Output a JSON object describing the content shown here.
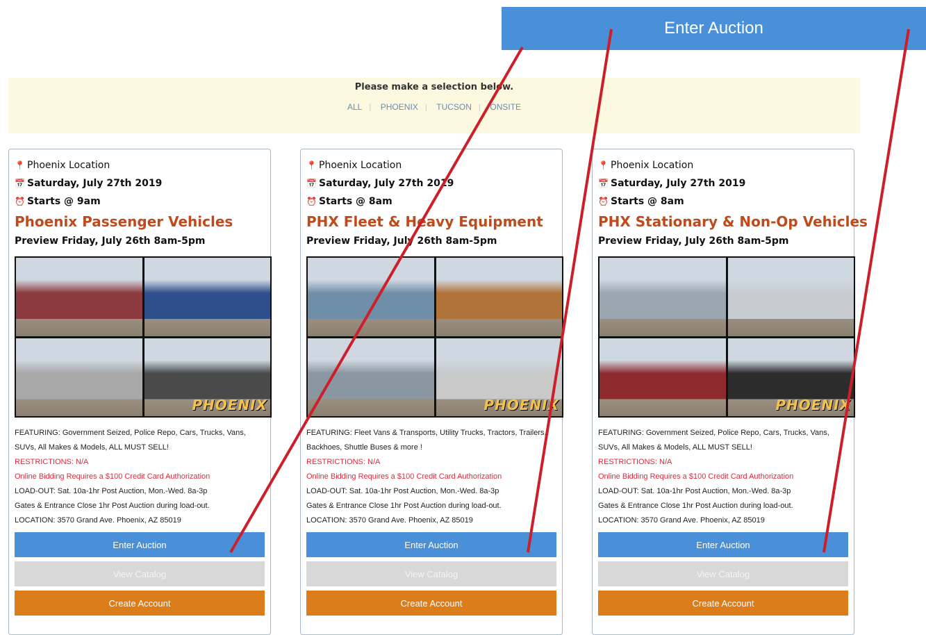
{
  "callout": {
    "label": "Enter Auction"
  },
  "filter": {
    "prompt": "Please make a selection below.",
    "options": [
      "ALL",
      "PHOENIX",
      "TUCSON",
      "ONSITE"
    ]
  },
  "cards": [
    {
      "location": "Phoenix Location",
      "date": "Saturday, July 27th 2019",
      "starts": "Starts @ 9am",
      "title": "Phoenix Passenger Vehicles",
      "preview": "Preview Friday, July 26th 8am-5pm",
      "watermark": "PHOENIX",
      "featuring": "FEATURING: Government Seized, Police Repo, Cars, Trucks, Vans, SUVs, All Makes & Models, ALL MUST SELL!",
      "restrictions": "RESTRICTIONS: N/A",
      "online": "Online Bidding Requires a $100 Credit Card Authorization",
      "loadout": "LOAD-OUT: Sat. 10a-1hr Post Auction, Mon.-Wed. 8a-3p",
      "gates": "Gates & Entrance Close 1hr Post Auction during load-out.",
      "address": "LOCATION: 3570 Grand Ave. Phoenix, AZ 85019",
      "enter": "Enter Auction",
      "catalog": "View Catalog",
      "account": "Create Account",
      "photo_colors": [
        "#8c3a3e",
        "#2e4f8c",
        "#a8a8a8",
        "#4a4a4a"
      ]
    },
    {
      "location": "Phoenix Location",
      "date": "Saturday, July 27th 2019",
      "starts": "Starts @ 8am",
      "title": "PHX Fleet & Heavy Equipment",
      "preview": "Preview Friday, July 26th 8am-5pm",
      "watermark": "PHOENIX",
      "featuring": "FEATURING: Fleet Vans & Transports, Utility Trucks, Tractors, Trailers, Backhoes, Shuttle Buses & more !",
      "restrictions": "RESTRICTIONS: N/A",
      "online": "Online Bidding Requires a $100 Credit Card Authorization",
      "loadout": "LOAD-OUT: Sat. 10a-1hr Post Auction, Mon.-Wed. 8a-3p",
      "gates": "Gates & Entrance Close 1hr Post Auction during load-out.",
      "address": "LOCATION: 3570 Grand Ave. Phoenix, AZ 85019",
      "enter": "Enter Auction",
      "catalog": "View Catalog",
      "account": "Create Account",
      "photo_colors": [
        "#6f8ea8",
        "#b0733a",
        "#8a96a0",
        "#c9c9c9"
      ]
    },
    {
      "location": "Phoenix Location",
      "date": "Saturday, July 27th 2019",
      "starts": "Starts @ 8am",
      "title": "PHX Stationary & Non-Op Vehicles",
      "preview": "Preview Friday, July 26th 8am-5pm",
      "watermark": "PHOENIX",
      "featuring": "FEATURING: Government Seized, Police Repo, Cars, Trucks, Vans, SUVs, All Makes & Models, ALL MUST SELL!",
      "restrictions": "RESTRICTIONS: N/A",
      "online": "Online Bidding Requires a $100 Credit Card Authorization",
      "loadout": "LOAD-OUT: Sat. 10a-1hr Post Auction, Mon.-Wed. 8a-3p",
      "gates": "Gates & Entrance Close 1hr Post Auction during load-out.",
      "address": "LOCATION: 3570 Grand Ave. Phoenix, AZ 85019",
      "enter": "Enter Auction",
      "catalog": "View Catalog",
      "account": "Create Account",
      "photo_colors": [
        "#9aa6b0",
        "#c8ccd0",
        "#8e2a2e",
        "#2c2c2c"
      ]
    }
  ],
  "colors": {
    "primary": "#4a90d9",
    "title": "#c04a1a",
    "alert": "#e0283a",
    "account": "#dc7d1c",
    "arrow": "#cc1f2a"
  }
}
